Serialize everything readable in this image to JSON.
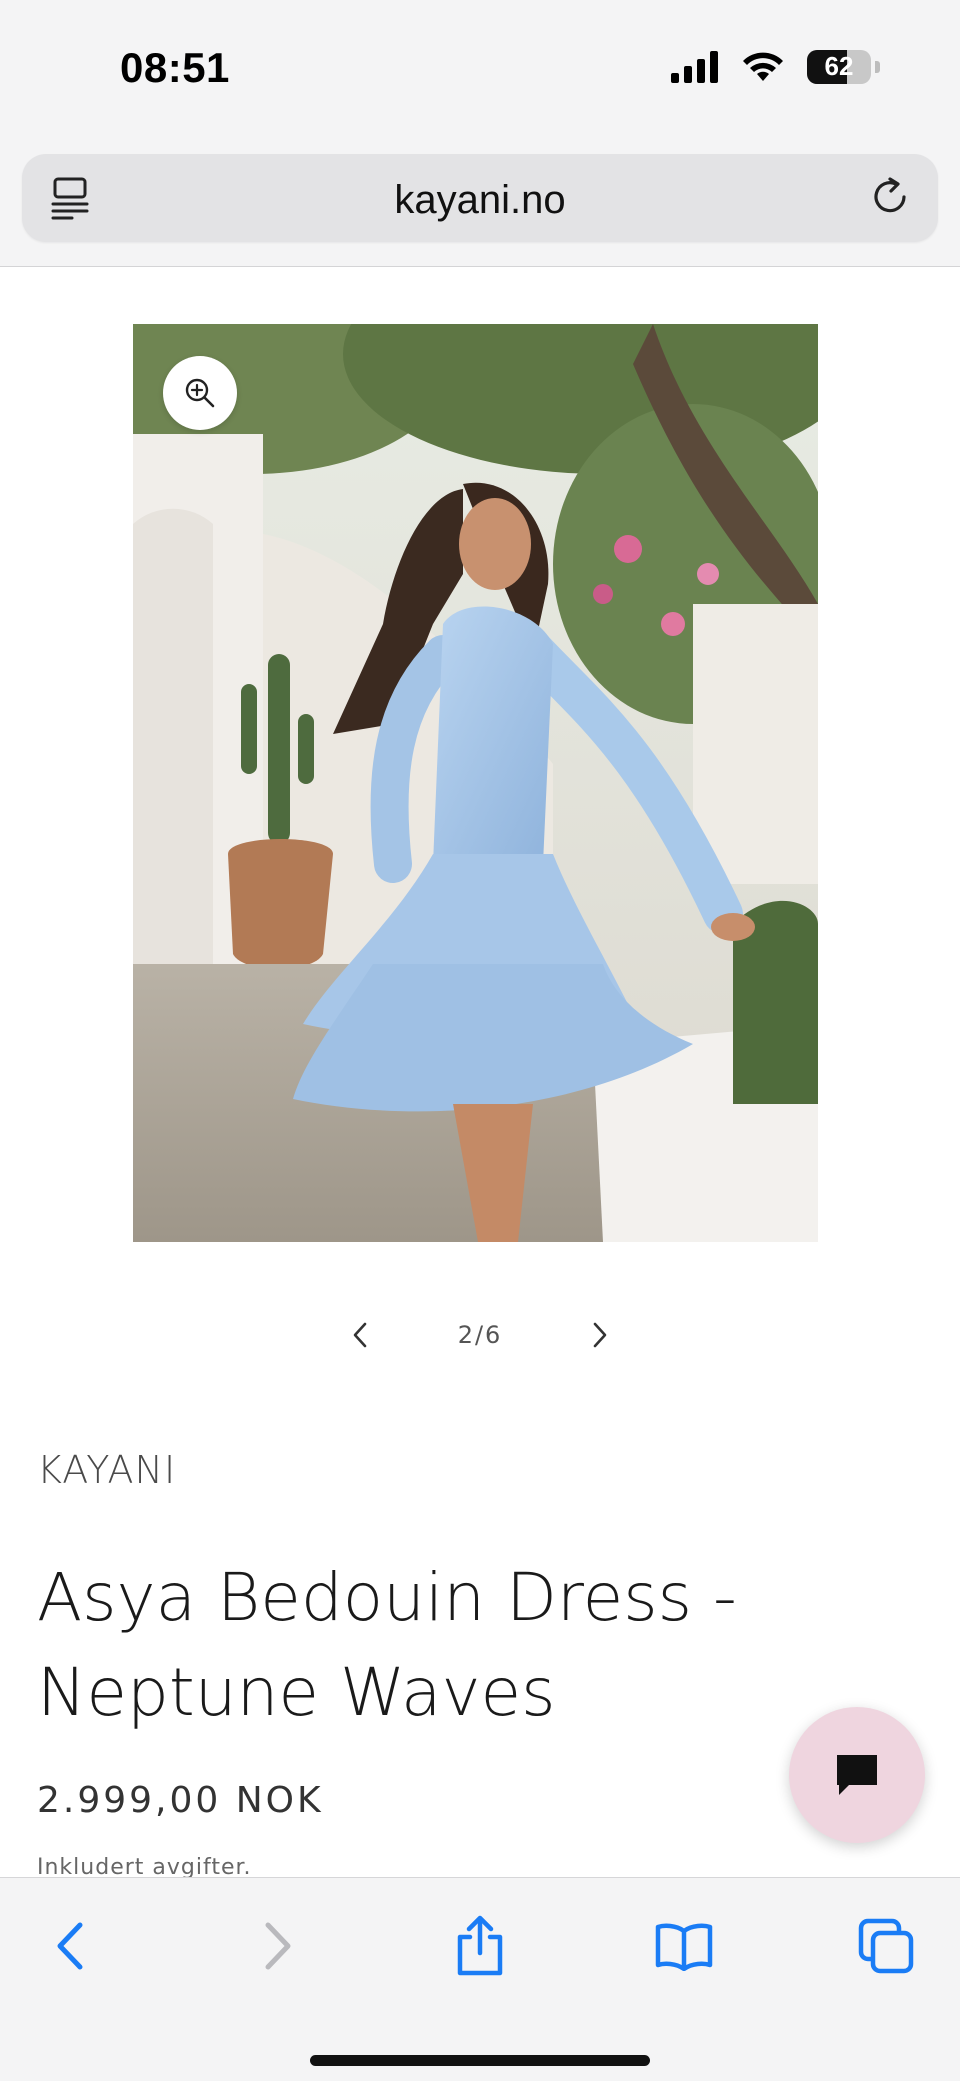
{
  "status_bar": {
    "time": "08:51",
    "battery_level": "62",
    "battery_fraction": 0.62,
    "icons": [
      "cellular-signal-icon",
      "wifi-icon",
      "battery-icon"
    ]
  },
  "browser": {
    "url": "kayani.no",
    "icons": [
      "reader-view-icon",
      "reload-icon"
    ]
  },
  "gallery": {
    "image_alt": "Woman twirling in a light blue tiered dress in a whitewashed garden",
    "counter": "2/6"
  },
  "product": {
    "brand": "KAYANI",
    "title": "Asya Bedouin Dress - Neptune Waves",
    "price": "2.999,00 NOK",
    "tax_note": "Inkludert avgifter."
  },
  "chat": {
    "icon": "chat-bubble-icon"
  },
  "toolbar": {
    "items": [
      "back-icon",
      "forward-icon",
      "share-icon",
      "bookmarks-icon",
      "tabs-icon"
    ]
  },
  "colors": {
    "accent_blue": "#1a7cf5",
    "chat_bg": "#efd5df",
    "dress_blue": "#a9c9ea"
  }
}
